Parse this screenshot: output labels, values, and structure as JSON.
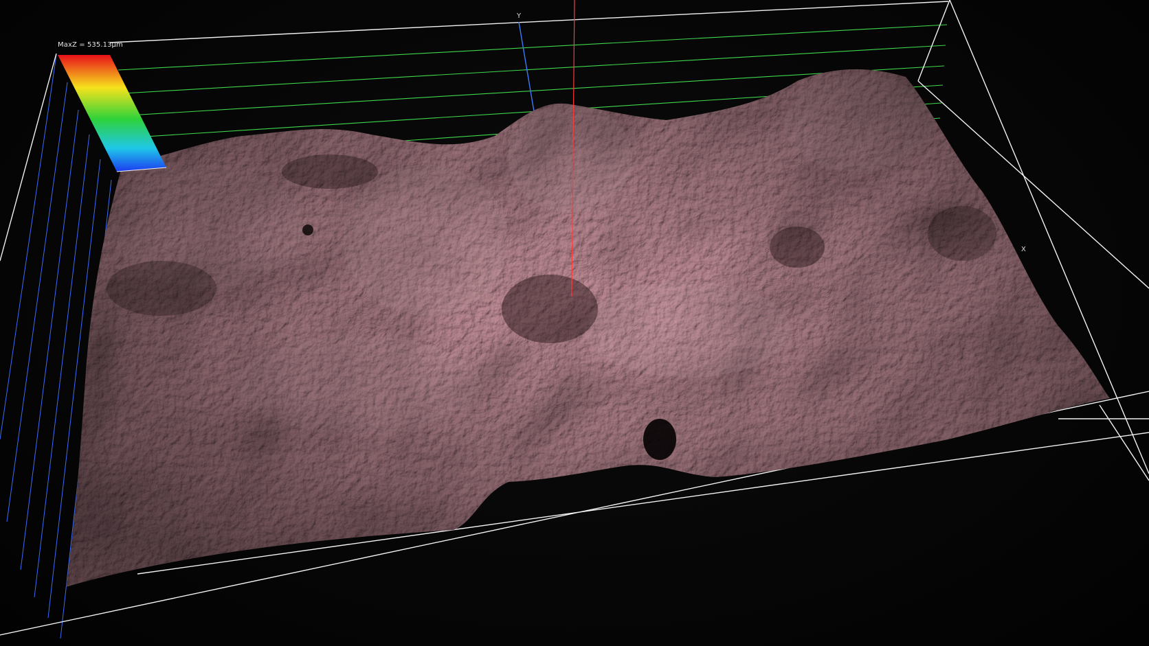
{
  "viewer": {
    "max_z_label": "MaxZ = 535.13μm",
    "axis_y_label": "Y",
    "axis_x_label": "X"
  },
  "colors": {
    "background": "#060606",
    "bounding_box": "#f2f2f2",
    "grid_back_wall": "#3fd94c",
    "grid_side_wall": "#3a6cff",
    "y_axis": "#3a7bff",
    "cursor_line": "#ff3b3b",
    "surface_base": "#8a5c64",
    "surface_highlight": "#d8b0b6",
    "surface_shadow": "#2a171b"
  },
  "color_scale": {
    "stops": [
      "#e8101a",
      "#f6e21c",
      "#2fd23a",
      "#1fc7e8",
      "#1c3cf0"
    ]
  },
  "icons": {
    "surface": "height-map-surface-icon",
    "scale": "color-scale-bar-icon"
  }
}
